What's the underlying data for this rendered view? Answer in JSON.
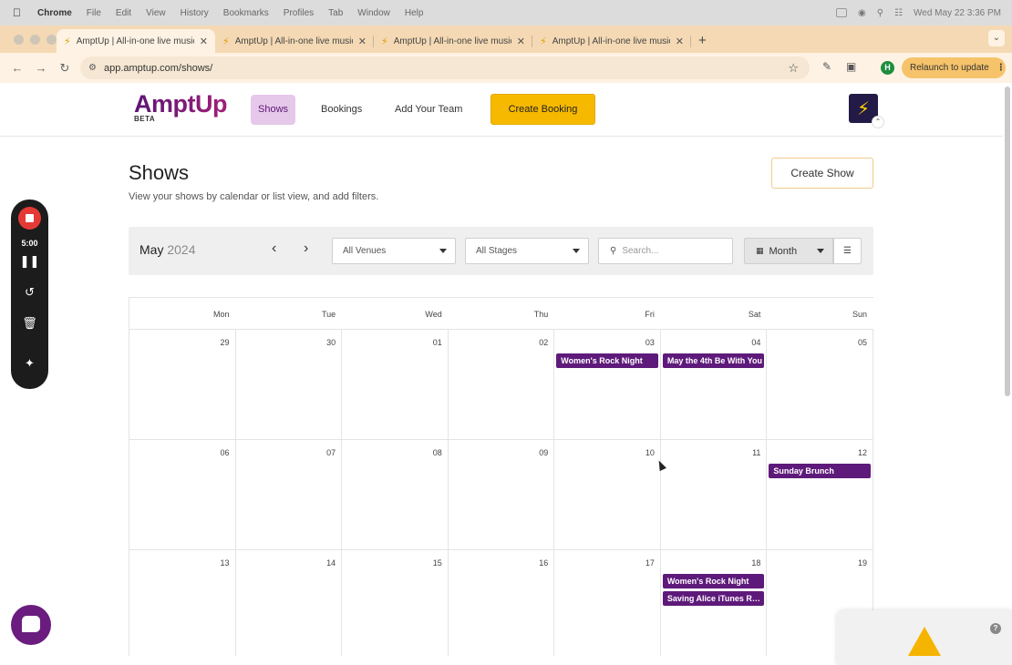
{
  "menubar": {
    "app": "Chrome",
    "items": [
      "File",
      "Edit",
      "View",
      "History",
      "Bookmarks",
      "Profiles",
      "Tab",
      "Window",
      "Help"
    ],
    "clock": "Wed May 22  3:36 PM"
  },
  "tabs": [
    {
      "title": "AmptUp | All-in-one live music"
    },
    {
      "title": "AmptUp | All-in-one live music"
    },
    {
      "title": "AmptUp | All-in-one live music"
    },
    {
      "title": "AmptUp | All-in-one live music"
    }
  ],
  "toolbar": {
    "url": "app.amptup.com/shows/",
    "profile_initial": "H",
    "relaunch_label": "Relaunch to update"
  },
  "app": {
    "logo": "AmptUp",
    "logo_badge": "BETA",
    "nav": {
      "shows": "Shows",
      "bookings": "Bookings",
      "team": "Add Your Team"
    },
    "create_booking": "Create Booking"
  },
  "page": {
    "title": "Shows",
    "subtitle": "View your shows by calendar or list view, and add filters.",
    "create_show": "Create Show"
  },
  "filters": {
    "month": "May",
    "year": "2024",
    "venues": "All Venues",
    "stages": "All Stages",
    "search_placeholder": "Search...",
    "view": "Month"
  },
  "calendar": {
    "weekdays": [
      "Mon",
      "Tue",
      "Wed",
      "Thu",
      "Fri",
      "Sat",
      "Sun"
    ],
    "weeks": [
      [
        "29",
        "30",
        "01",
        "02",
        "03",
        "04",
        "05"
      ],
      [
        "06",
        "07",
        "08",
        "09",
        "10",
        "11",
        "12"
      ],
      [
        "13",
        "14",
        "15",
        "16",
        "17",
        "18",
        "19"
      ]
    ],
    "events": [
      {
        "week": 0,
        "day": 4,
        "slot": 0,
        "title": "Women's Rock Night"
      },
      {
        "week": 0,
        "day": 5,
        "slot": 0,
        "title": "May the 4th Be With You"
      },
      {
        "week": 1,
        "day": 6,
        "slot": 0,
        "title": "Sunday Brunch"
      },
      {
        "week": 2,
        "day": 5,
        "slot": 0,
        "title": "Women's Rock Night"
      },
      {
        "week": 2,
        "day": 5,
        "slot": 1,
        "title": "Saving Alice iTunes Release"
      }
    ]
  },
  "recorder": {
    "time": "5:00"
  },
  "colors": {
    "brand": "#5e1a7a",
    "accent": "#f6b900",
    "nav_active": "#e6c8ea"
  }
}
